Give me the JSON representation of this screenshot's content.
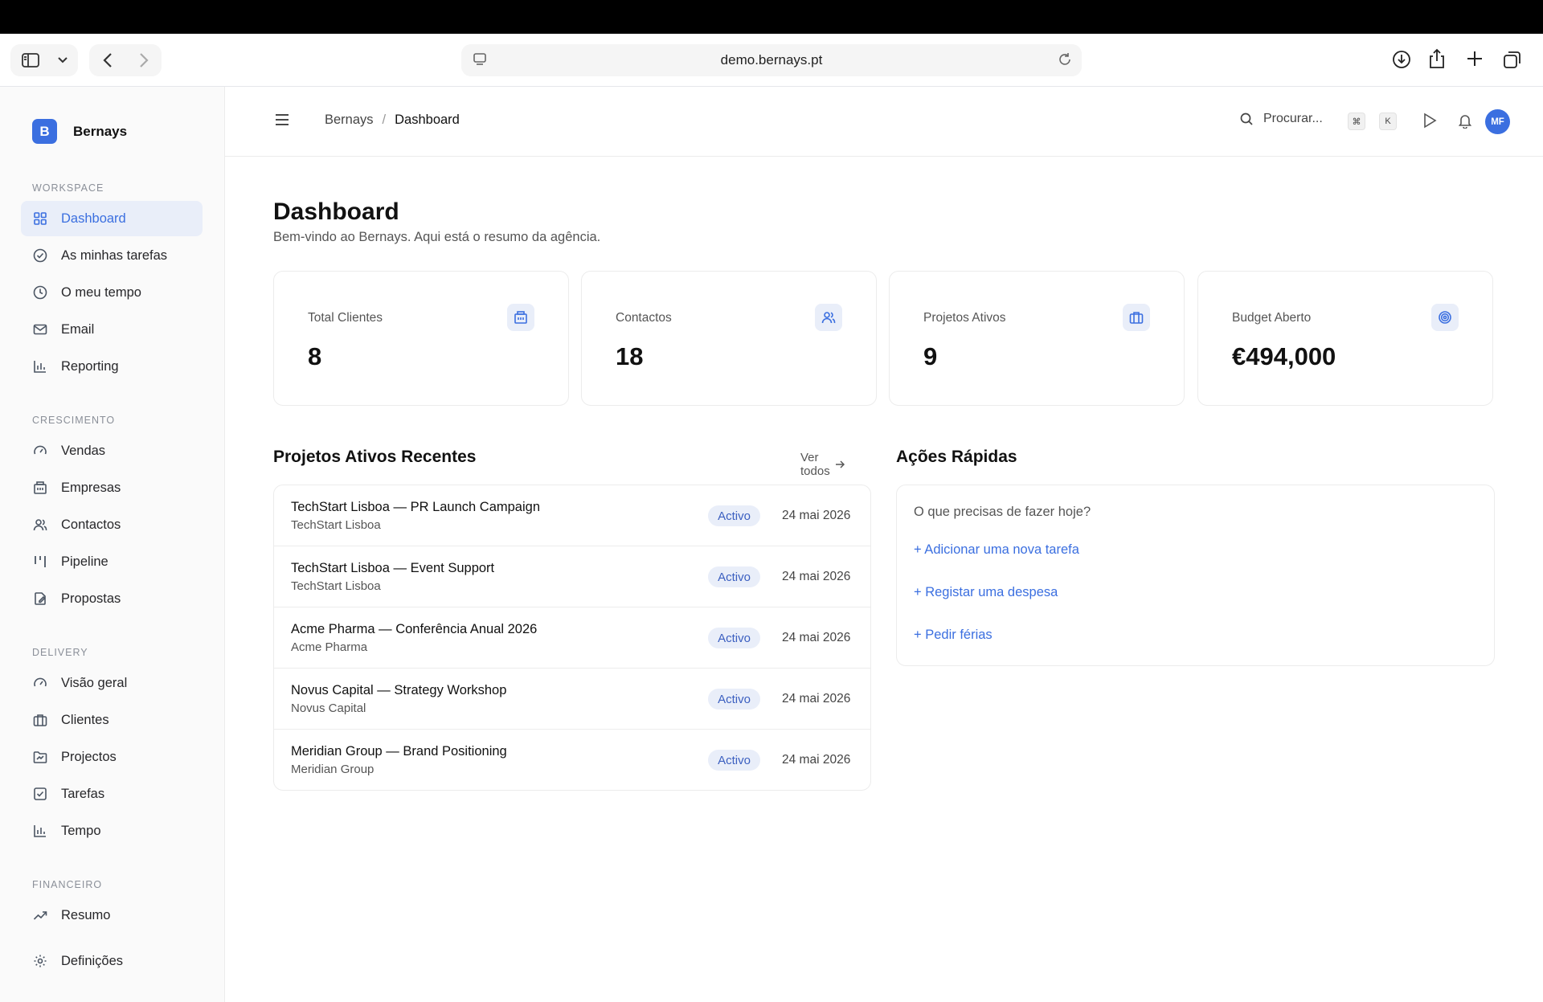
{
  "browser": {
    "url": "demo.bernays.pt"
  },
  "app": {
    "logo_letter": "B",
    "name": "Bernays"
  },
  "sidebar": {
    "sections": [
      {
        "title": "WORKSPACE",
        "items": [
          {
            "label": "Dashboard",
            "icon": "grid-icon",
            "active": true
          },
          {
            "label": "As minhas tarefas",
            "icon": "check-circle-icon"
          },
          {
            "label": "O meu tempo",
            "icon": "clock-icon"
          },
          {
            "label": "Email",
            "icon": "mail-icon"
          },
          {
            "label": "Reporting",
            "icon": "bar-chart-icon"
          }
        ]
      },
      {
        "title": "CRESCIMENTO",
        "items": [
          {
            "label": "Vendas",
            "icon": "gauge-icon"
          },
          {
            "label": "Empresas",
            "icon": "building-icon"
          },
          {
            "label": "Contactos",
            "icon": "users-icon"
          },
          {
            "label": "Pipeline",
            "icon": "kanban-icon"
          },
          {
            "label": "Propostas",
            "icon": "file-edit-icon"
          }
        ]
      },
      {
        "title": "DELIVERY",
        "items": [
          {
            "label": "Visão geral",
            "icon": "gauge-icon"
          },
          {
            "label": "Clientes",
            "icon": "briefcase-icon"
          },
          {
            "label": "Projectos",
            "icon": "folder-icon"
          },
          {
            "label": "Tarefas",
            "icon": "check-square-icon"
          },
          {
            "label": "Tempo",
            "icon": "bar-chart-icon"
          }
        ]
      },
      {
        "title": "FINANCEIRO",
        "items": [
          {
            "label": "Resumo",
            "icon": "trending-up-icon"
          }
        ]
      }
    ],
    "settings_label": "Definições"
  },
  "header": {
    "breadcrumb_root": "Bernays",
    "breadcrumb_sep": "/",
    "breadcrumb_current": "Dashboard",
    "search_placeholder": "Procurar...",
    "kbd_cmd": "⌘",
    "kbd_k": "K",
    "avatar_initials": "MF"
  },
  "page": {
    "title": "Dashboard",
    "subtitle": "Bem-vindo ao Bernays. Aqui está o resumo da agência."
  },
  "stats": [
    {
      "label": "Total Clientes",
      "value": "8",
      "icon": "building-icon"
    },
    {
      "label": "Contactos",
      "value": "18",
      "icon": "users-icon"
    },
    {
      "label": "Projetos Ativos",
      "value": "9",
      "icon": "briefcase-icon"
    },
    {
      "label": "Budget Aberto",
      "value": "€494,000",
      "icon": "target-icon"
    }
  ],
  "projects": {
    "title": "Projetos Ativos Recentes",
    "view_all": "Ver todos",
    "rows": [
      {
        "title": "TechStart Lisboa — PR Launch Campaign",
        "client": "TechStart Lisboa",
        "status": "Activo",
        "date": "24 mai 2026"
      },
      {
        "title": "TechStart Lisboa — Event Support",
        "client": "TechStart Lisboa",
        "status": "Activo",
        "date": "24 mai 2026"
      },
      {
        "title": "Acme Pharma — Conferência Anual 2026",
        "client": "Acme Pharma",
        "status": "Activo",
        "date": "24 mai 2026"
      },
      {
        "title": "Novus Capital — Strategy Workshop",
        "client": "Novus Capital",
        "status": "Activo",
        "date": "24 mai 2026"
      },
      {
        "title": "Meridian Group — Brand Positioning",
        "client": "Meridian Group",
        "status": "Activo",
        "date": "24 mai 2026"
      }
    ]
  },
  "quick_actions": {
    "title": "Ações Rápidas",
    "question": "O que precisas de fazer hoje?",
    "actions": [
      "+ Adicionar uma nova tarefa",
      "+ Registar uma despesa",
      "+ Pedir férias"
    ]
  },
  "colors": {
    "accent": "#3b6fe0",
    "badge_bg": "#e9eef9"
  }
}
